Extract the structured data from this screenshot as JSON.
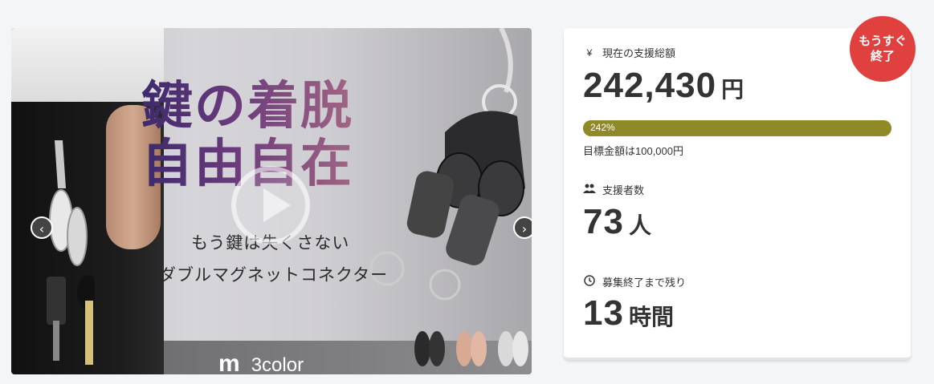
{
  "hero": {
    "headline": "鍵の着脱\n自由自在",
    "subtitle_1": "もう鍵は失くさない",
    "subtitle_2": "ダブルマグネットコネクター",
    "brand_logo": "m",
    "brand_text": "3color",
    "prev_icon": "chevron-left-icon",
    "next_icon": "chevron-right-icon",
    "play_icon": "play-icon"
  },
  "badge": {
    "line1": "もうすぐ",
    "line2": "終了",
    "color": "#e0413f"
  },
  "funding": {
    "label": "現在の支援総額",
    "icon": "yen-icon",
    "amount": "242,430",
    "unit": "円",
    "percent_label": "242%",
    "percent": 242,
    "bar_color": "#8f8a27",
    "target_text": "目標金額は100,000円"
  },
  "supporters": {
    "label": "支援者数",
    "icon": "users-icon",
    "count": "73",
    "unit": "人"
  },
  "remaining": {
    "label": "募集終了まで残り",
    "icon": "clock-icon",
    "value": "13",
    "unit": "時間"
  }
}
